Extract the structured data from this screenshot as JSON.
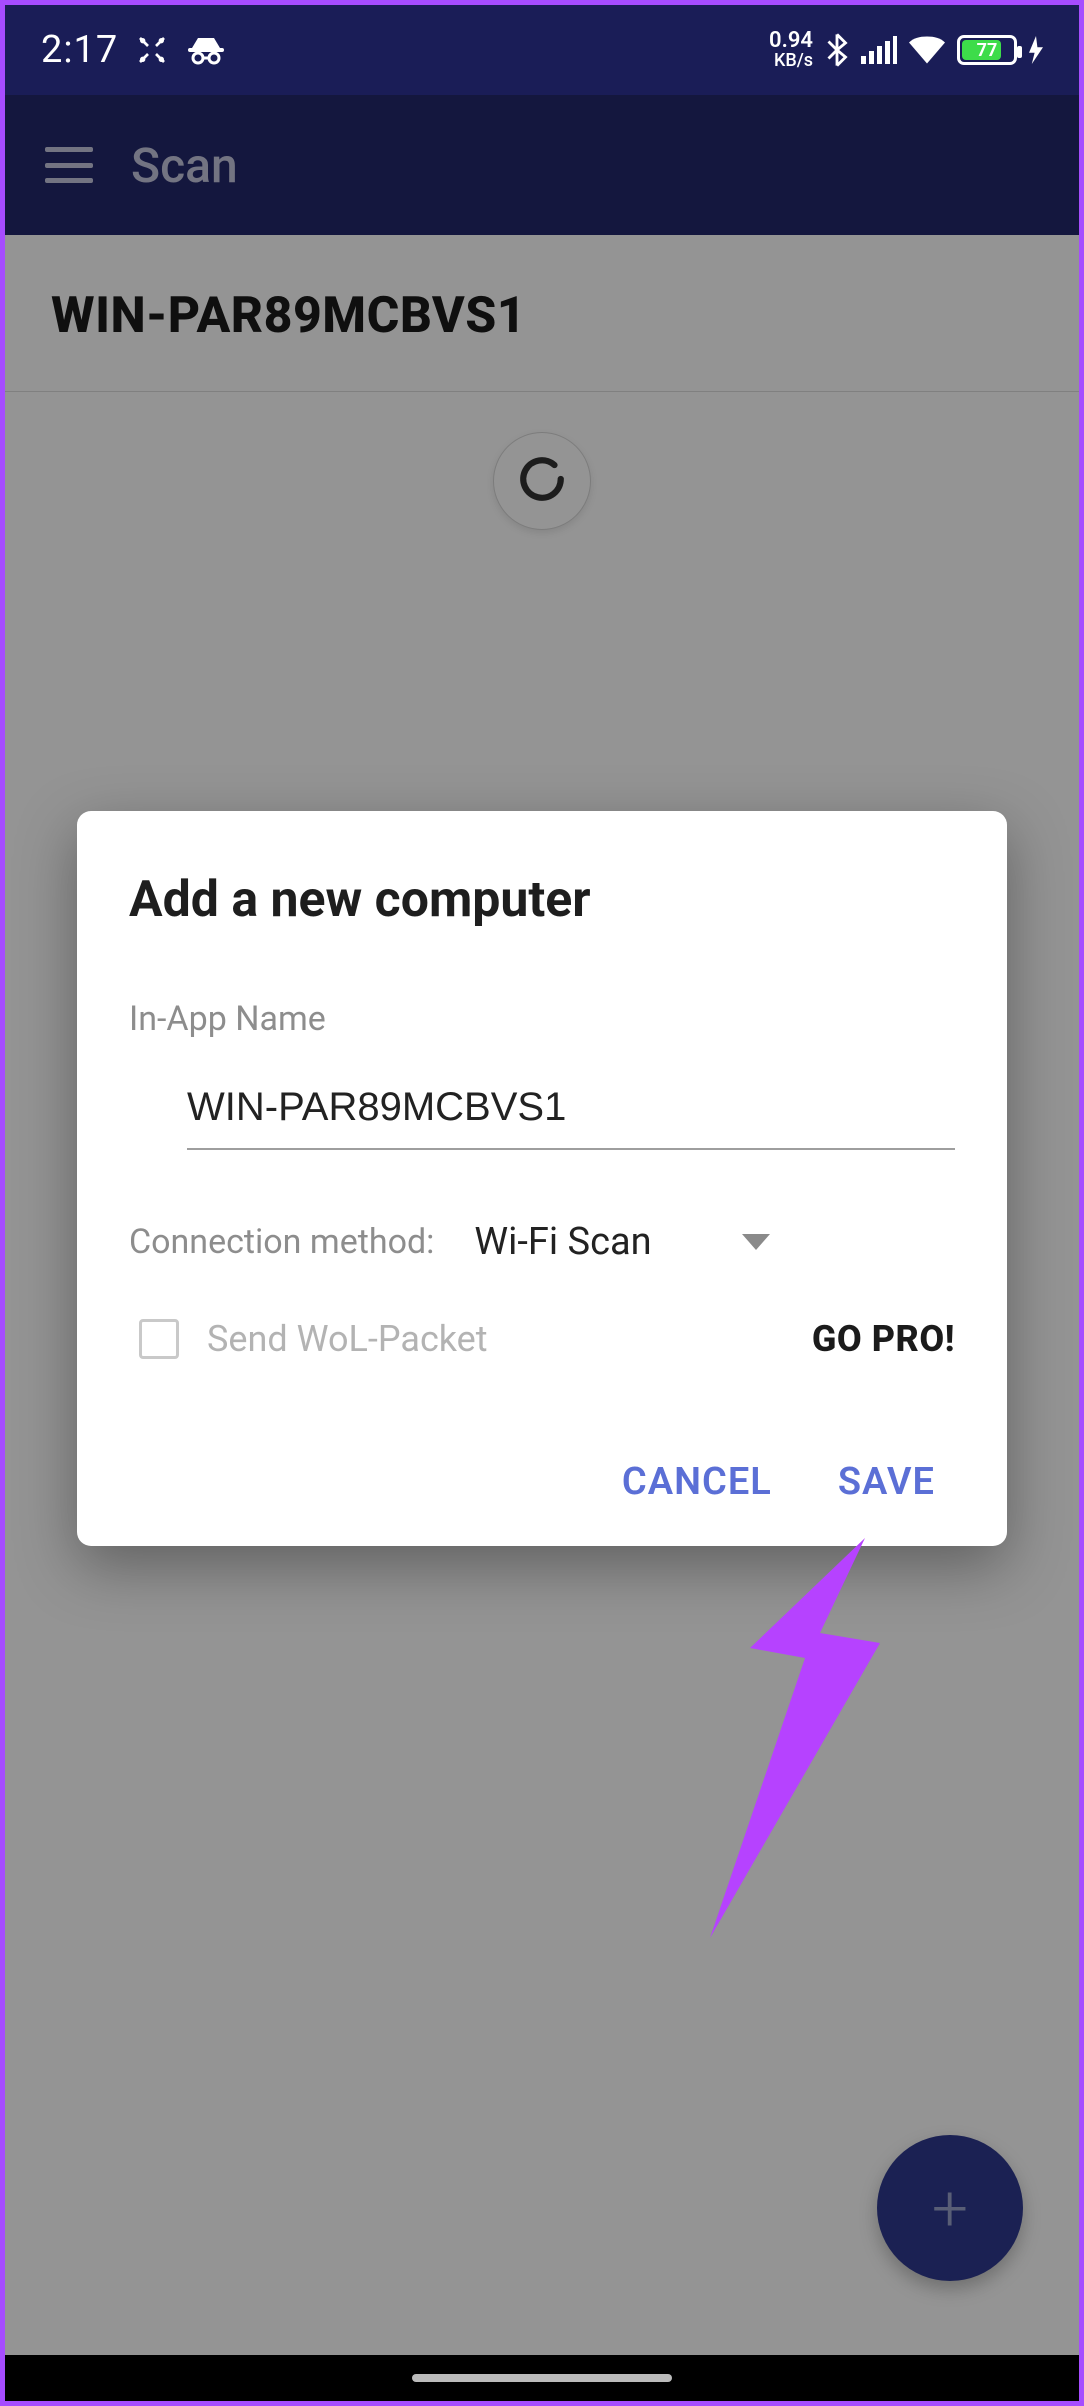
{
  "status": {
    "time": "2:17",
    "net_speed_value": "0.94",
    "net_speed_unit": "KB/s",
    "battery_percent": "77"
  },
  "app_bar": {
    "title": "Scan"
  },
  "main": {
    "host_name": "WIN-PAR89MCBVS1"
  },
  "dialog": {
    "title": "Add a new computer",
    "in_app_name_label": "In-App Name",
    "in_app_name_value": "WIN-PAR89MCBVS1",
    "connection_method_label": "Connection method:",
    "connection_method_value": "Wi-Fi Scan",
    "wol_label": "Send WoL-Packet",
    "go_pro_label": "GO PRO!",
    "cancel_label": "CANCEL",
    "save_label": "SAVE"
  },
  "fab": {
    "plus": "+"
  }
}
